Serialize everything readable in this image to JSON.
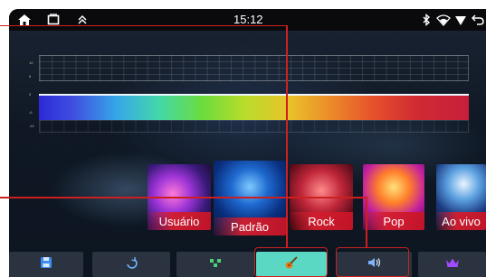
{
  "status_bar": {
    "time": "15:12",
    "left_icons": [
      "home-icon",
      "recent-apps-icon",
      "collapse-up-icon"
    ],
    "right_icons": [
      "bluetooth-icon",
      "wifi-icon",
      "location-icon",
      "back-icon"
    ]
  },
  "equalizer": {
    "scale_labels": [
      "12",
      "6",
      "0",
      "-6",
      "-12"
    ]
  },
  "presets": [
    {
      "label": "Usuário"
    },
    {
      "label": "Padrão",
      "selected": true
    },
    {
      "label": "Rock"
    },
    {
      "label": "Pop"
    },
    {
      "label": "Ao vivo"
    }
  ],
  "bottom_bar": {
    "buttons": [
      {
        "name": "save",
        "icon": "save-icon"
      },
      {
        "name": "reset",
        "icon": "reset-icon"
      },
      {
        "name": "balance",
        "icon": "speaker-balance-icon"
      },
      {
        "name": "equalizer",
        "icon": "guitar-icon",
        "active": true
      },
      {
        "name": "volume",
        "icon": "volume-icon"
      },
      {
        "name": "premium",
        "icon": "crown-icon"
      }
    ]
  },
  "colors": {
    "accent": "#5ad8c4",
    "annotation": "#cc2020",
    "preset_label_bg": "#d21e2e",
    "status_bar_bg": "#0a0a0c"
  }
}
